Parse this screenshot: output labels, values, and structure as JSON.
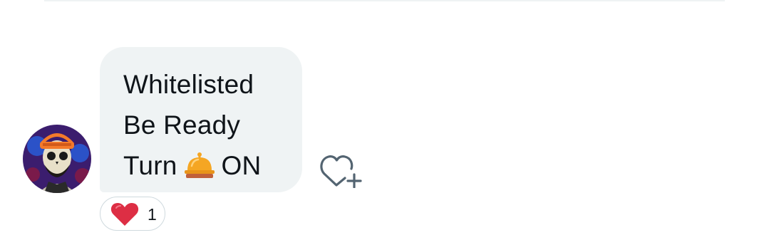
{
  "message": {
    "lines": [
      "Whitelisted",
      "Be Ready",
      "Turn",
      "ON"
    ],
    "bell": {
      "icon": "bellhop-bell-icon",
      "color": "#f5a623",
      "base_color": "#c0603a"
    }
  },
  "reaction": {
    "icon": "red-heart-icon",
    "count": "1",
    "color": "#e0245e"
  },
  "actions": {
    "add_reaction_icon": "heart-plus-icon"
  },
  "avatar": {
    "icon": "skull-avatar-icon",
    "colors": {
      "background": "#3b1d6e",
      "cap": "#f47a2a",
      "face": "#e8e0c8"
    }
  },
  "colors": {
    "bubble": "#eff3f4",
    "text": "#0f1419",
    "border": "#cfd9de",
    "icon_gray": "#536471"
  }
}
